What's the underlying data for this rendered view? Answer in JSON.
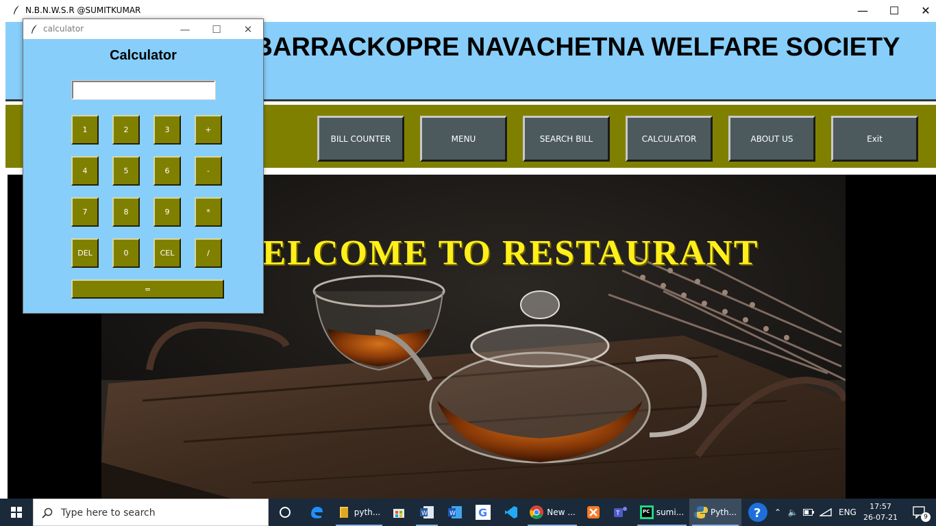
{
  "main_window": {
    "title": "N.B.N.W.S.R @SUMITKUMAR",
    "controls": {
      "minimize": "—",
      "maximize": "☐",
      "close": "✕"
    }
  },
  "header": {
    "org_title": "BARRACKOPRE NAVACHETNA WELFARE SOCIETY",
    "bg_color": "#87cefa"
  },
  "nav": {
    "bg_color": "#808000",
    "buttons": [
      {
        "label": "BILL COUNTER"
      },
      {
        "label": "MENU"
      },
      {
        "label": "SEARCH BILL"
      },
      {
        "label": "CALCULATOR"
      },
      {
        "label": "ABOUT US"
      },
      {
        "label": "Exit"
      }
    ]
  },
  "hero": {
    "welcome_text": "WELCOME TO RESTAURANT",
    "welcome_color": "#ffef1a"
  },
  "calculator": {
    "window_title": "calculator",
    "controls": {
      "minimize": "—",
      "maximize": "☐",
      "close": "✕"
    },
    "heading": "Calculator",
    "display_value": "",
    "keys": [
      [
        "1",
        "2",
        "3",
        "+"
      ],
      [
        "4",
        "5",
        "6",
        "-"
      ],
      [
        "7",
        "8",
        "9",
        "*"
      ],
      [
        "DEL",
        "0",
        "CEL",
        "/"
      ]
    ],
    "equals_label": "=",
    "key_color": "#808000"
  },
  "taskbar": {
    "search_placeholder": "Type here to search",
    "apps": [
      {
        "name": "cortana",
        "label": ""
      },
      {
        "name": "edge",
        "label": ""
      },
      {
        "name": "file-explorer",
        "label": "pyth..."
      },
      {
        "name": "store",
        "label": ""
      },
      {
        "name": "word-file",
        "label": ""
      },
      {
        "name": "word",
        "label": ""
      },
      {
        "name": "google",
        "label": ""
      },
      {
        "name": "vscode",
        "label": ""
      },
      {
        "name": "chrome",
        "label": "New ..."
      },
      {
        "name": "xampp",
        "label": ""
      },
      {
        "name": "teams",
        "label": ""
      },
      {
        "name": "pycharm",
        "label": "sumi..."
      },
      {
        "name": "python",
        "label": "Pyth..."
      }
    ],
    "language": "ENG",
    "time": "17:57",
    "date": "26-07-21",
    "notification_count": "9"
  }
}
